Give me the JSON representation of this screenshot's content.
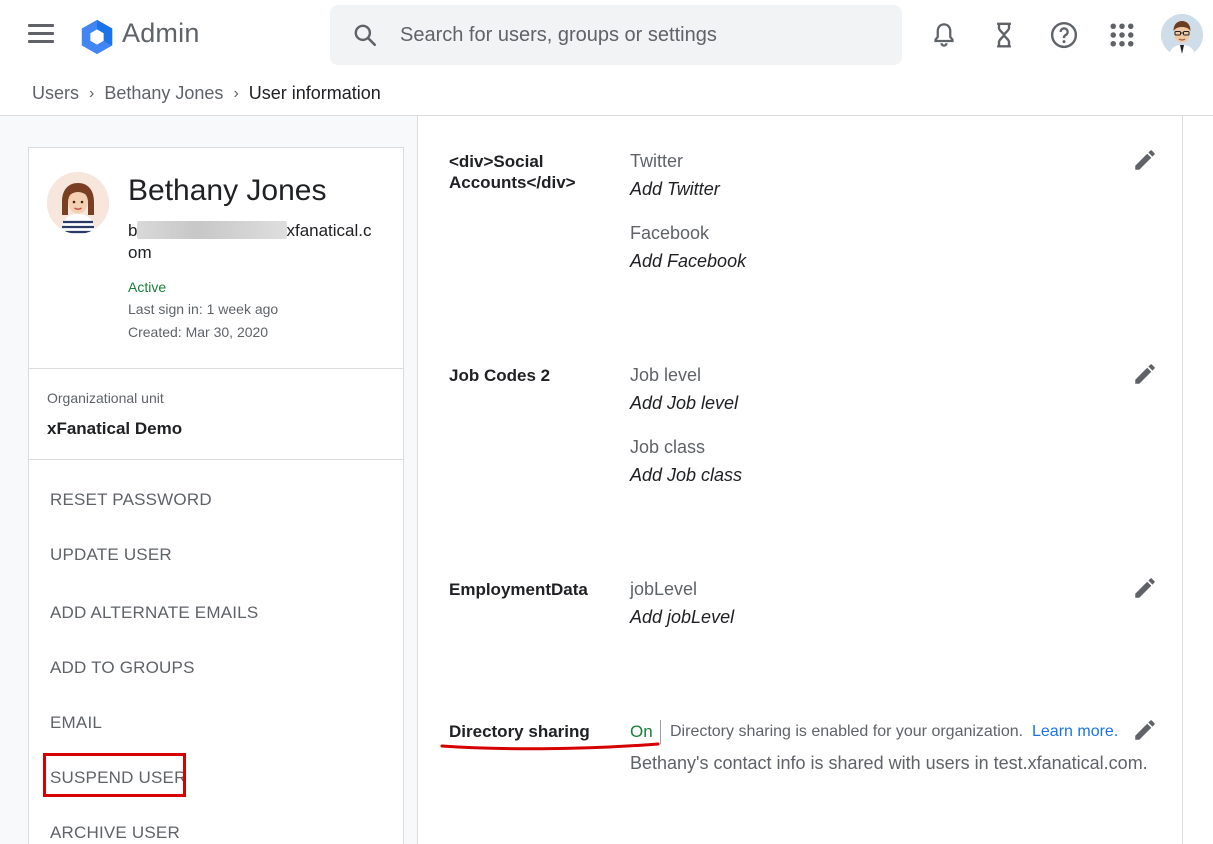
{
  "header": {
    "brand": "Admin",
    "search_placeholder": "Search for users, groups or settings",
    "icons": [
      "menu-icon",
      "admin-logo-icon",
      "search-icon",
      "bell-icon",
      "hourglass-icon",
      "help-icon",
      "apps-grid-icon",
      "account-avatar"
    ]
  },
  "breadcrumb": {
    "items": [
      "Users",
      "Bethany Jones",
      "User information"
    ]
  },
  "user": {
    "name": "Bethany Jones",
    "email_prefix": "b",
    "email_suffix_1": "xfanatical.c",
    "email_suffix_2": "om",
    "status": "Active",
    "last_sign_in": "Last sign in: 1 week ago",
    "created": "Created: Mar 30, 2020"
  },
  "org_unit": {
    "label": "Organizational unit",
    "value": "xFanatical Demo"
  },
  "actions": [
    "RESET PASSWORD",
    "UPDATE USER",
    "ADD ALTERNATE EMAILS",
    "ADD TO GROUPS",
    "EMAIL",
    "SUSPEND USER",
    "ARCHIVE USER"
  ],
  "sections": {
    "social": {
      "label_1": "<div>Social",
      "label_2": "Accounts</div>",
      "fields": [
        {
          "label": "Twitter",
          "value": "Add Twitter"
        },
        {
          "label": "Facebook",
          "value": "Add Facebook"
        }
      ]
    },
    "job_codes": {
      "label": "Job Codes 2",
      "fields": [
        {
          "label": "Job level",
          "value": "Add Job level"
        },
        {
          "label": "Job class",
          "value": "Add Job class"
        }
      ]
    },
    "employment": {
      "label": "EmploymentData",
      "fields": [
        {
          "label": "jobLevel",
          "value": "Add jobLevel"
        }
      ]
    },
    "directory": {
      "label": "Directory sharing",
      "state": "On",
      "description": "Directory sharing is enabled for your organization.",
      "link": "Learn more.",
      "sub": "Bethany's contact info is shared with users in test.xfanatical.com."
    }
  },
  "colors": {
    "active_green": "#188038",
    "highlight_red": "#d50000",
    "link_blue": "#1a73e8"
  }
}
